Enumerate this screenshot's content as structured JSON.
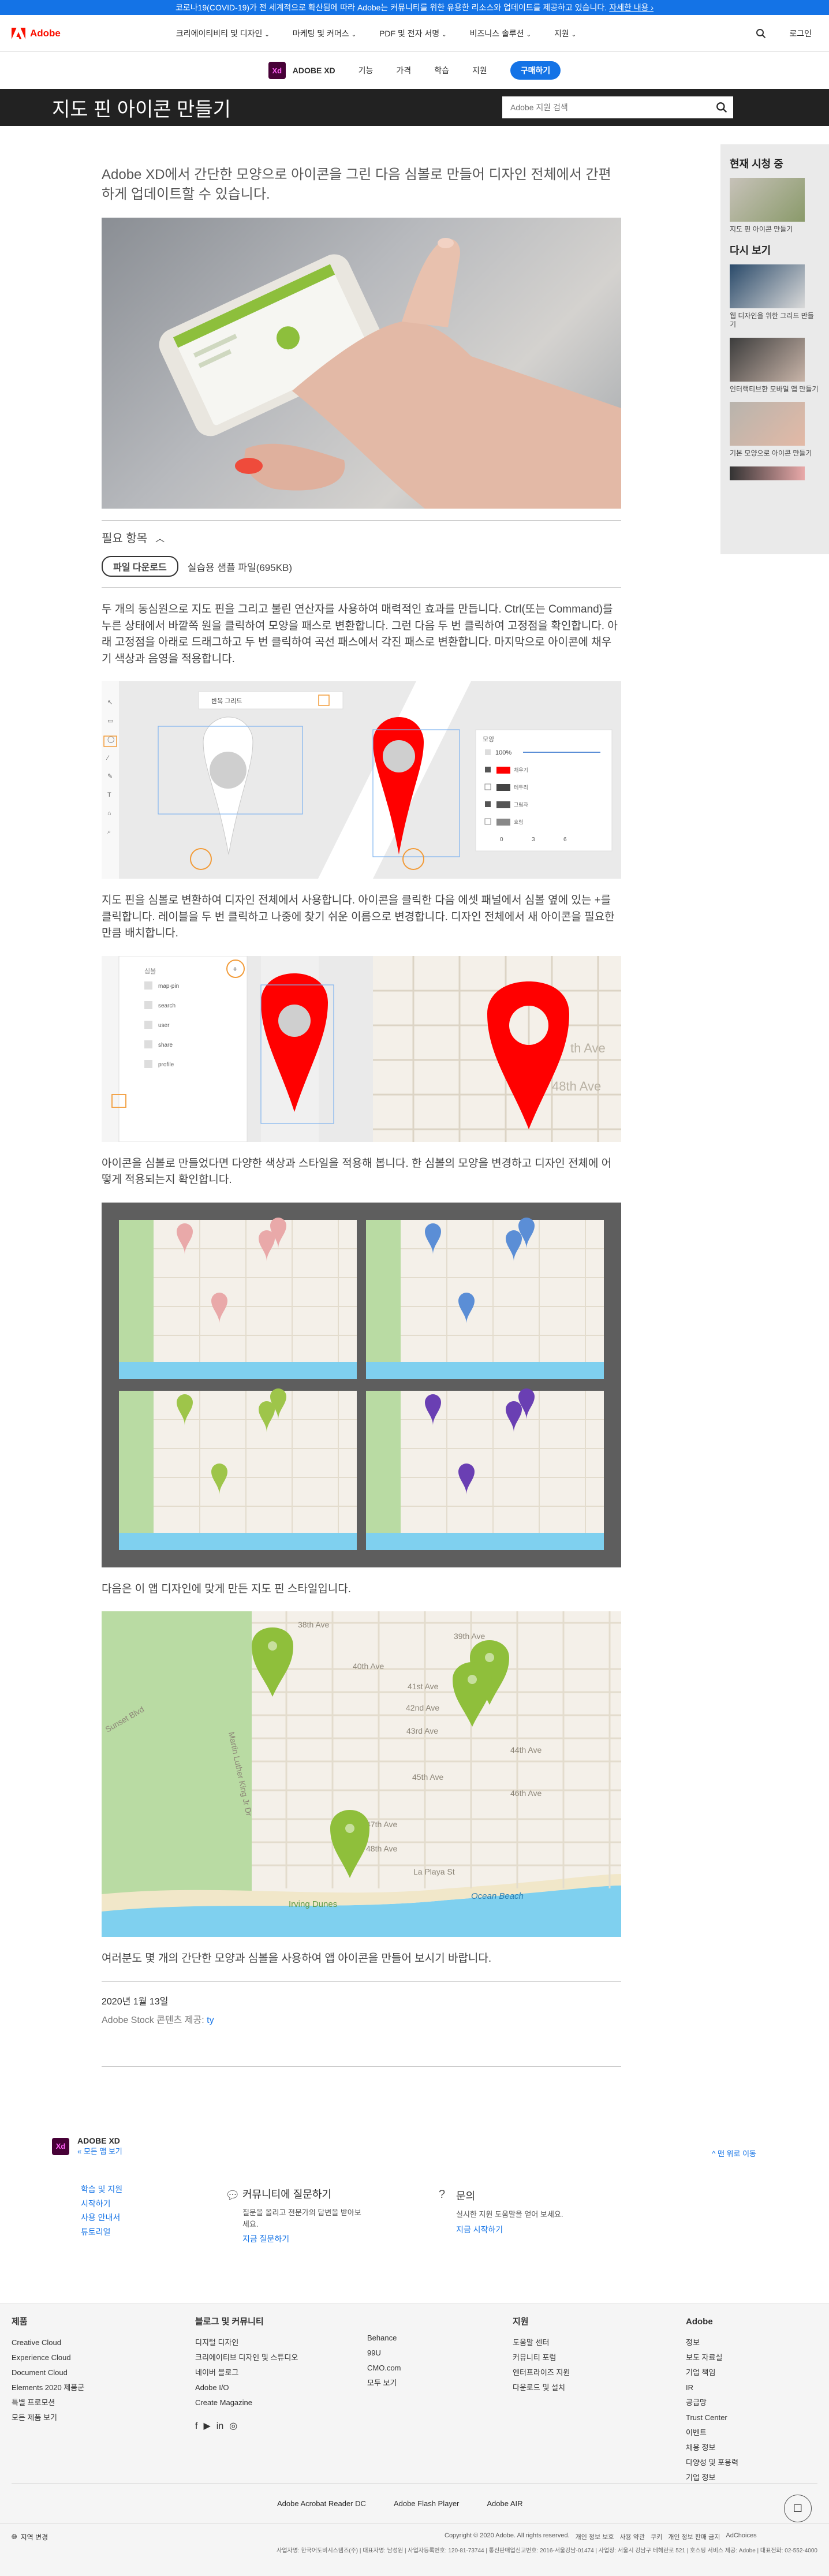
{
  "banner": {
    "text": "코로나19(COVID-19)가 전 세계적으로 확산됨에 따라 Adobe는 커뮤니티를 위한 유용한 리소스와 업데이트를 제공하고 있습니다.",
    "link": "자세한 내용 ›"
  },
  "gnav": {
    "logo": "Adobe",
    "menu": [
      "크리에이티비티 및 디자인",
      "마케팅 및 커머스",
      "PDF 및 전자 서명",
      "비즈니스 솔루션",
      "지원"
    ],
    "login": "로그인"
  },
  "localnav": {
    "product": "ADOBE XD",
    "badge": "Xd",
    "items": [
      "기능",
      "가격",
      "학습",
      "지원"
    ],
    "buy": "구매하기"
  },
  "title": "지도 핀 아이콘 만들기",
  "search": {
    "placeholder": "Adobe 지원 검색"
  },
  "intro": "Adobe XD에서 간단한 모양으로 아이콘을 그린 다음 심볼로 만들어 디자인 전체에서 간편하게 업데이트할 수 있습니다.",
  "needs": {
    "heading": "필요 항목",
    "download": "파일 다운로드",
    "sample": "실습용 샘플 파일(695KB)"
  },
  "p1": "두 개의 동심원으로 지도 핀을 그리고 불린 연산자를 사용하여 매력적인 효과를 만듭니다. Ctrl(또는 Command)를 누른 상태에서 바깥쪽 원을 클릭하여 모양을 패스로 변환합니다. 그런 다음 두 번 클릭하여 고정점을 확인합니다. 아래 고정점을 아래로 드래그하고 두 번 클릭하여 곡선 패스에서 각진 패스로 변환합니다. 마지막으로 아이콘에 채우기 색상과 음영을 적용합니다.",
  "p2": "지도 핀을 심볼로 변환하여 디자인 전체에서 사용합니다. 아이콘을 클릭한 다음 에셋 패널에서 심볼 옆에 있는 +를 클릭합니다. 레이블을 두 번 클릭하고 나중에 찾기 쉬운 이름으로 변경합니다. 디자인 전체에서 새 아이콘을 필요한 만큼 배치합니다.",
  "p3": "아이콘을 심볼로 만들었다면 다양한 색상과 스타일을 적용해 봅니다. 한 심볼의 모양을 변경하고 디자인 전체에 어떻게 적용되는지 확인합니다.",
  "p4": "다음은 이 앱 디자인에 맞게 만든 지도 핀 스타일입니다.",
  "p5": "여러분도 몇 개의 간단한 모양과 심볼을 사용하여 앱 아이콘을 만들어 보시기 바랍니다.",
  "date": "2020년 1월 13일",
  "credit": {
    "prefix": "Adobe Stock 콘텐츠 제공:",
    "name": "ty"
  },
  "sidebar": {
    "current": "현재 시청 중",
    "current_cap": "지도 핀 아이콘 만들기",
    "next": "다시 보기",
    "items": [
      "웹 디자인을 위한 그리드 만들기",
      "인터랙티브한 모바일 앱 만들기",
      "기본 모양으로 아이콘 만들기"
    ]
  },
  "editor": {
    "toolbar_label": "반복 그리드",
    "panel_title": "모양",
    "opacity": "100%",
    "rows": [
      "채우기",
      "테두리",
      "그림자",
      "흐림"
    ],
    "nums": [
      "0",
      "3",
      "6"
    ]
  },
  "assets": {
    "title": "심볼",
    "items": [
      "map-pin",
      "search",
      "user",
      "share",
      "profile"
    ]
  },
  "maplabels": [
    "38th Ave",
    "39th Ave",
    "40th Ave",
    "41st Ave",
    "42nd Ave",
    "43rd Ave",
    "44th Ave",
    "45th Ave",
    "46th Ave",
    "47th Ave",
    "48th Ave",
    "La Playa St",
    "Irving Dunes",
    "Ocean Beach",
    "Martin Luther King Jr Dr",
    "Sunset Blvd"
  ],
  "mapzoom": [
    "th Ave",
    "48th Ave"
  ],
  "footer_top": {
    "product": "ADOBE XD",
    "all_apps": "« 모든 앱 보기",
    "back_top": "^ 맨 위로 이동",
    "links": [
      "학습 및 지원",
      "시작하기",
      "사용 안내서",
      "튜토리얼"
    ],
    "ask_title": "커뮤니티에 질문하기",
    "ask_desc": "질문을 올리고 전문가의 답변을 받아보세요.",
    "ask_link": "지금 질문하기",
    "contact_title": "문의",
    "contact_desc": "실시한 지원 도움말을 얻어 보세요.",
    "contact_link": "지금 시작하기"
  },
  "footer": {
    "cols": [
      {
        "title": "제품",
        "items": [
          "Creative Cloud",
          "Experience Cloud",
          "Document Cloud",
          "Elements 2020 제품군",
          "특별 프로모션",
          "모든 제품 보기"
        ]
      },
      {
        "title": "블로그 및 커뮤니티",
        "items": [
          "디지털 디자인",
          "크리에이티브 디자인 및 스튜디오",
          "네이버 블로그",
          "Adobe I/O",
          "Create Magazine"
        ]
      },
      {
        "title": "",
        "items": [
          "Behance",
          "99U",
          "CMO.com",
          "모두 보기"
        ]
      },
      {
        "title": "지원",
        "items": [
          "도움말 센터",
          "커뮤니티 포럼",
          "엔터프라이즈 지원",
          "다운로드 및 설치"
        ]
      },
      {
        "title": "Adobe",
        "items": [
          "정보",
          "보도 자료실",
          "기업 책임",
          "IR",
          "공급망",
          "Trust Center",
          "이벤트",
          "채용 정보",
          "다양성 및 포용력",
          "기업 정보"
        ]
      }
    ],
    "apps": [
      "Adobe Acrobat Reader DC",
      "Adobe Flash Player",
      "Adobe AIR"
    ],
    "region": "지역 변경",
    "copyright": "Copyright © 2020 Adobe. All rights reserved.",
    "legal": [
      "개인 정보 보호",
      "사용 약관",
      "쿠키",
      "개인 정보 판매 금지"
    ],
    "adchoices": "AdChoices",
    "company": "사업자명: 한국어도비시스템즈(주) | 대표자명: 남성원 | 사업자등록번호: 120-81-73744 | 통신판매업신고번호: 2016-서울강남-01474 | 사업장: 서울시 강남구 테헤란로 521 | 호스팅 서비스 제공: Adobe | 대표전화: 02-552-4000"
  },
  "colors": {
    "accent": "#1473e6",
    "pin": "#ff0000",
    "pin_pink": "#e9a9a9",
    "pin_blue": "#5b8ed6",
    "pin_green": "#9ec54a",
    "pin_purple": "#6a3fb3",
    "water": "#7fd0ef",
    "park": "#b9dba3",
    "map_bg": "#f4f0e9"
  },
  "icons": [
    "search-icon",
    "chevron-down-icon",
    "chevron-up-icon",
    "chat-icon",
    "help-icon",
    "globe-icon",
    "facebook-icon",
    "youtube-icon",
    "linkedin-icon",
    "instagram-icon"
  ]
}
